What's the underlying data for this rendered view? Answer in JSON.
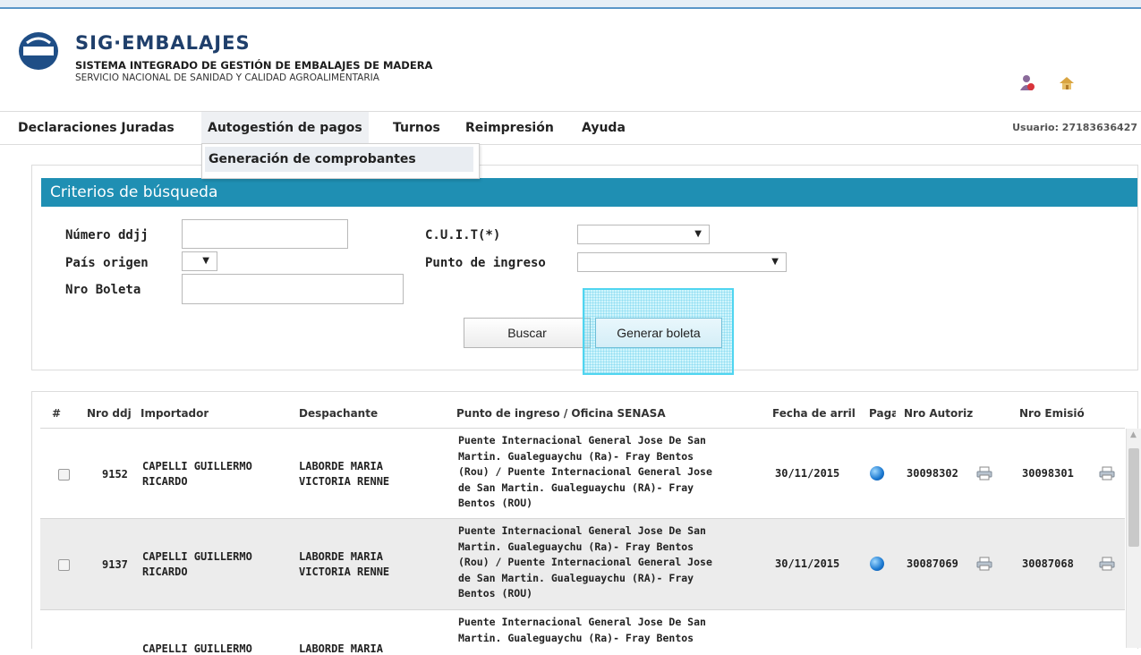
{
  "header": {
    "title": "SIG·EMBALAJES",
    "subtitle": "SISTEMA INTEGRADO DE GESTIÓN DE EMBALAJES DE MADERA",
    "organization": "SERVICIO NACIONAL DE SANIDAD Y CALIDAD AGROALIMENTARIA",
    "icons": [
      "user-icon",
      "home-icon"
    ]
  },
  "menu": {
    "items": [
      "Declaraciones Juradas",
      "Autogestión de pagos",
      "Turnos",
      "Reimpresión",
      "Ayuda"
    ],
    "user": "Usuario: 27183636427",
    "dropdown": [
      "Generación de comprobantes"
    ]
  },
  "search": {
    "title": "Criterios de búsqueda",
    "numero_ddjj_label": "Número ddjj",
    "numero_ddjj_value": "",
    "pais_origen_label": "País origen",
    "pais_origen_value": "",
    "nro_boleta_label": "Nro Boleta",
    "nro_boleta_value": "",
    "cuit_label": "C.U.I.T(*)",
    "cuit_value": "",
    "punto_ingreso_label": "Punto de ingreso",
    "punto_ingreso_value": "",
    "buscar_label": "Buscar",
    "generar_label": "Generar boleta"
  },
  "table": {
    "headers": [
      "#",
      "Nro ddj",
      "Importador",
      "Despachante",
      "Punto de ingreso / Oficina SENASA",
      "Fecha de arril",
      "Paga",
      "Nro Autoriz",
      "Nro Emisió"
    ],
    "rows": [
      {
        "nro": "9152",
        "importador": [
          "CAPELLI GUILLERMO",
          "RICARDO"
        ],
        "despachante": [
          "LABORDE MARIA",
          "VICTORIA RENNE"
        ],
        "punto": [
          "Puente Internacional General Jose De San",
          "Martin. Gualeguaychu (Ra)- Fray Bentos",
          "(Rou) / Puente Internacional General Jose",
          "de San Martin. Gualeguaychu (RA)- Fray",
          "Bentos (ROU)"
        ],
        "fecha": "30/11/2015",
        "autoriz": "30098302",
        "emision": "30098301"
      },
      {
        "nro": "9137",
        "importador": [
          "CAPELLI GUILLERMO",
          "RICARDO"
        ],
        "despachante": [
          "LABORDE MARIA",
          "VICTORIA RENNE"
        ],
        "punto": [
          "Puente Internacional General Jose De San",
          "Martin. Gualeguaychu (Ra)- Fray Bentos",
          "(Rou) / Puente Internacional General Jose",
          "de San Martin. Gualeguaychu (RA)- Fray",
          "Bentos (ROU)"
        ],
        "fecha": "30/11/2015",
        "autoriz": "30087069",
        "emision": "30087068"
      },
      {
        "importador": [
          "CAPELLI GUILLERMO"
        ],
        "despachante": [
          "LABORDE MARIA"
        ],
        "punto": [
          "Puente Internacional General Jose De San",
          "Martin. Gualeguaychu (Ra)- Fray Bentos"
        ]
      }
    ]
  },
  "colors": {
    "panel_header": "#1f8fb3",
    "brand": "#1f3f6b",
    "highlight": "#4fd5f0"
  }
}
